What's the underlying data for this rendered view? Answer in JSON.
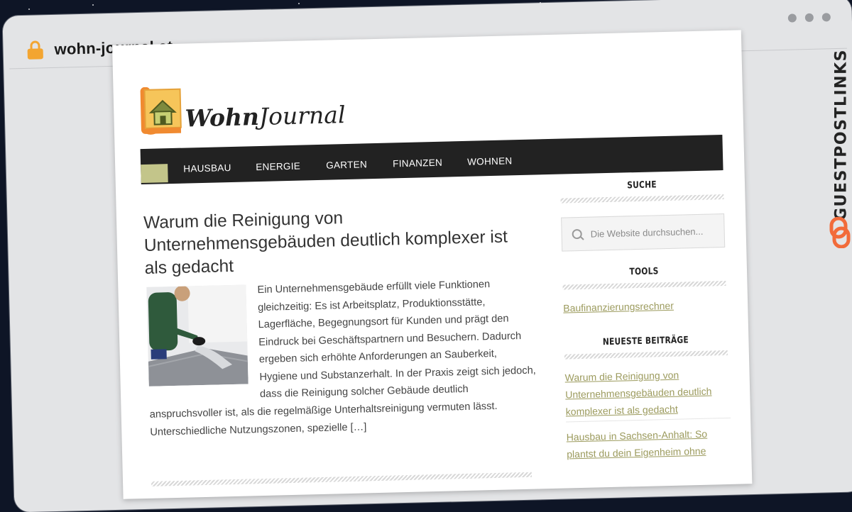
{
  "browser": {
    "url": "wohn-journal.at"
  },
  "site": {
    "logo": {
      "bold": "Wohn",
      "rest": "Journal"
    },
    "nav": [
      "HAUSBAU",
      "ENERGIE",
      "GARTEN",
      "FINANZEN",
      "WOHNEN"
    ]
  },
  "article": {
    "title": "Warum die Reinigung von Unternehmensgebäuden deutlich komplexer ist als gedacht",
    "excerpt_part1": "Ein Unternehmensgebäude erfüllt viele Funktionen gleichzeitig: Es ist Arbeitsplatz, Produktionsstätte, Lagerfläche, Begegnungsort für Kunden und prägt den Eindruck bei Geschäftspartnern und Besuchern. Dadurch ergeben sich erhöhte Anforderungen an Sauberkeit, Hygiene und Substanzerhalt. In der Praxis zeigt sich jedoch, dass die Reinigung solcher Gebäude deutlich",
    "excerpt_part2": "anspruchsvoller ist, als die regelmäßige Unterhaltsreinigung vermuten lässt. Unterschiedliche Nutzungszonen, spezielle […]"
  },
  "sidebar": {
    "search": {
      "title": "SUCHE",
      "placeholder": "Die Website durchsuchen..."
    },
    "tools": {
      "title": "TOOLS",
      "links": [
        "Baufinanzierungsrechner"
      ]
    },
    "recent": {
      "title": "NEUESTE BEITRÄGE",
      "links": [
        "Warum die Reinigung von Unternehmensgebäuden deutlich komplexer ist als gedacht",
        "Hausbau in Sachsen-Anhalt: So plantst du dein Eigenheim ohne"
      ]
    }
  },
  "watermark": {
    "text": "GUESTPOSTLINKS"
  },
  "colors": {
    "nav_bg": "#222222",
    "nav_accent": "#c3c58a",
    "link": "#9c9b5e",
    "lock": "#f3a531",
    "badge_orange": "#f26b3a"
  }
}
